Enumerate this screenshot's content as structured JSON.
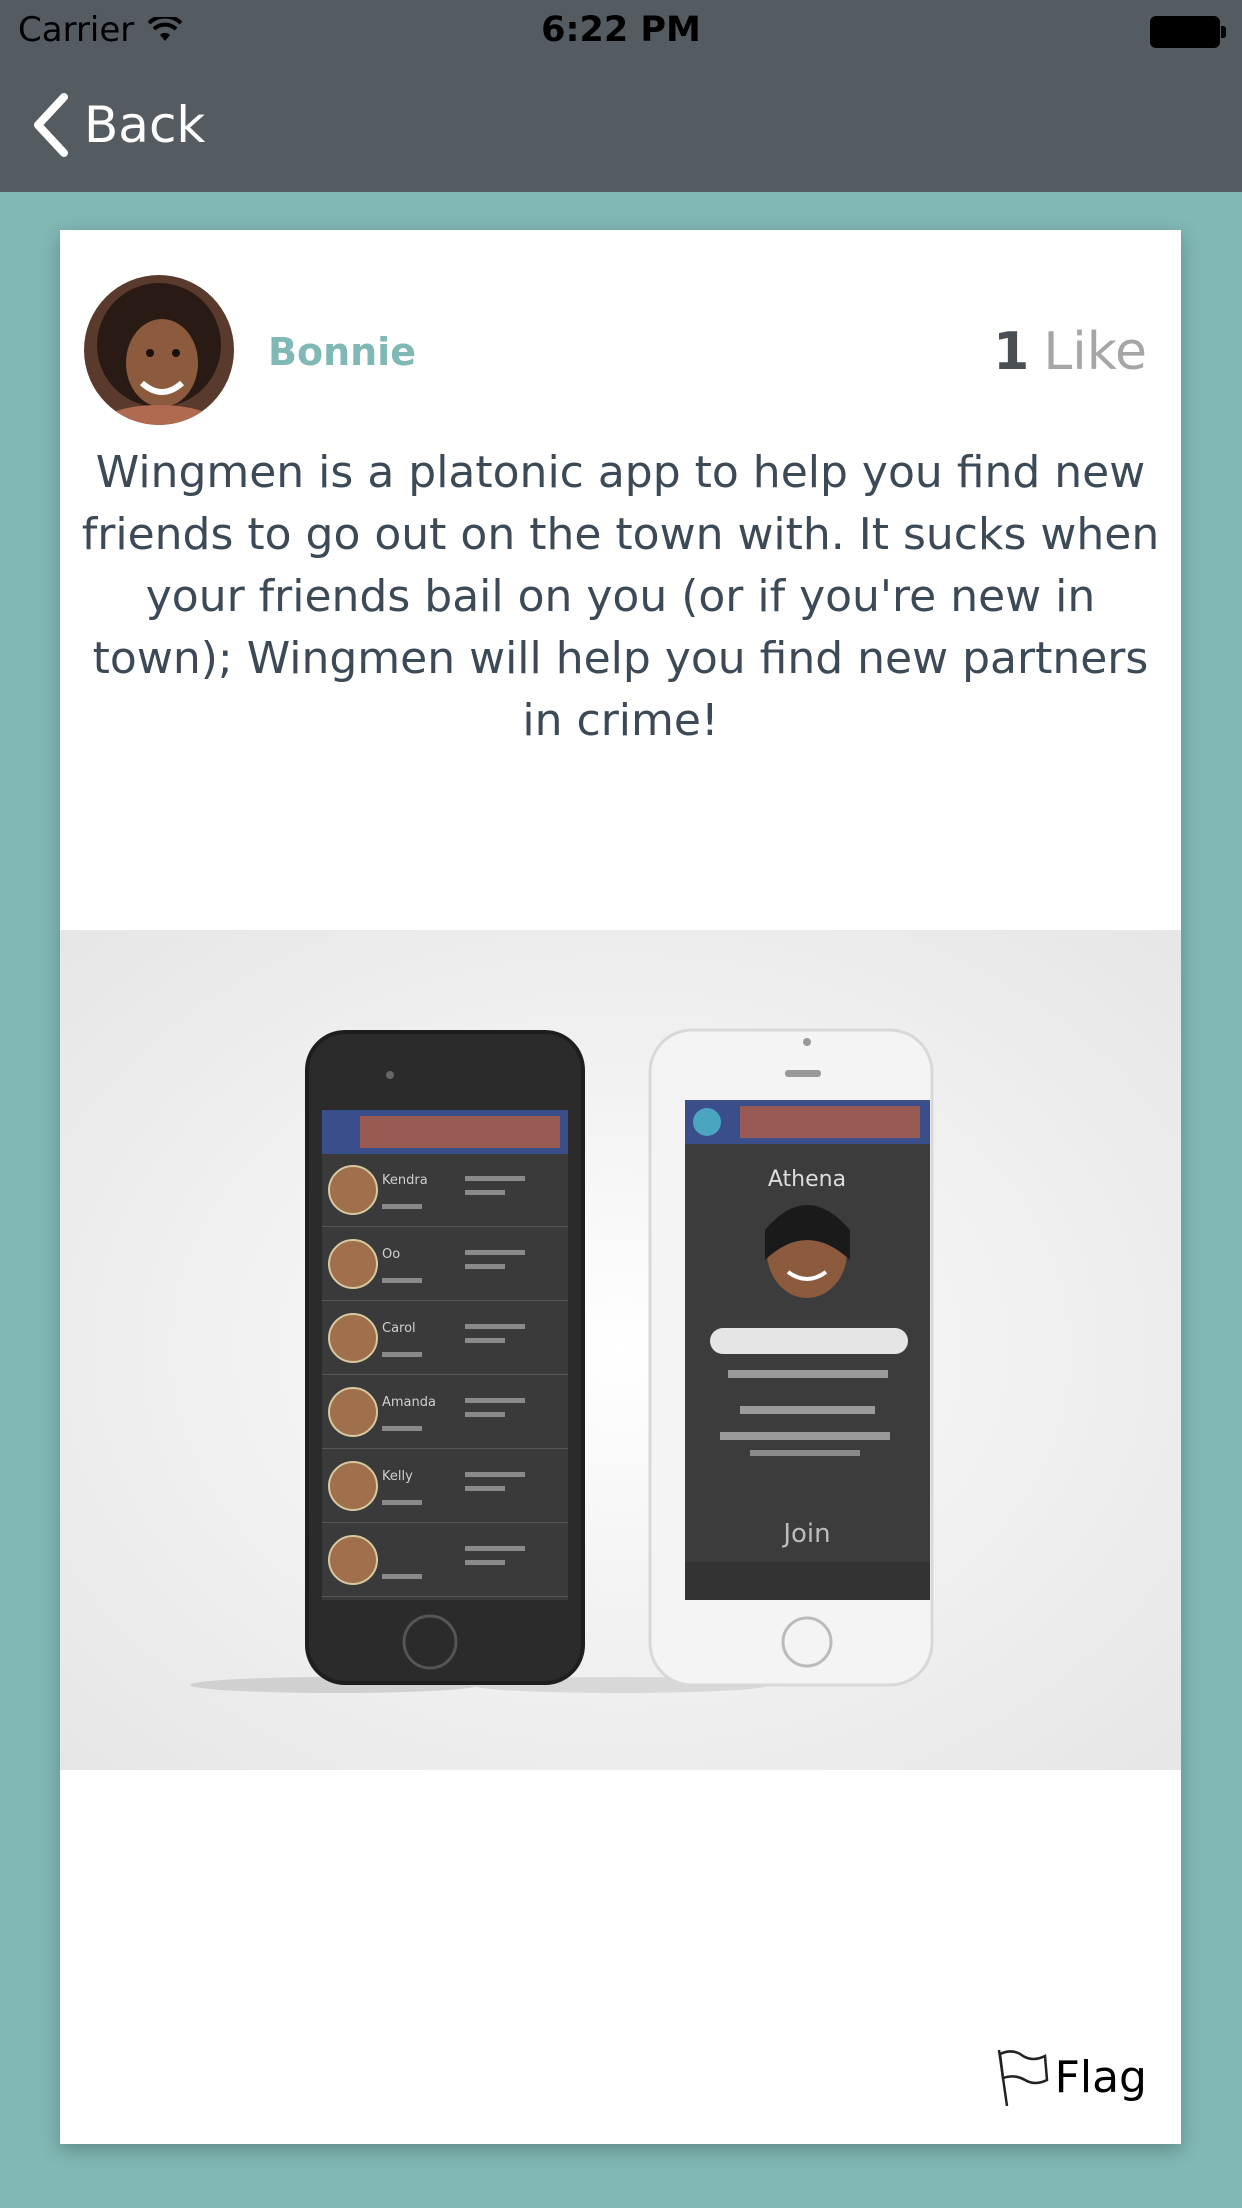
{
  "status_bar": {
    "carrier": "Carrier",
    "time": "6:22 PM"
  },
  "nav": {
    "back_label": "Back"
  },
  "post": {
    "author": "Bonnie",
    "like_count": "1",
    "like_label": "Like",
    "text": "Wingmen is a platonic app to help you find new friends to go out on the town with. It sucks when your friends bail on you (or if you're new in town); Wingmen will help you find new partners in crime!",
    "flag_label": "Flag",
    "image": {
      "left_phone_rows": [
        "Kendra",
        "Oo",
        "Carol",
        "Amanda",
        "Kelly",
        ""
      ],
      "right_phone_name": "Athena",
      "right_phone_button": "Join"
    }
  },
  "colors": {
    "accent": "#80b8b5",
    "nav_background": "#545b61",
    "text": "#3c4a57"
  }
}
